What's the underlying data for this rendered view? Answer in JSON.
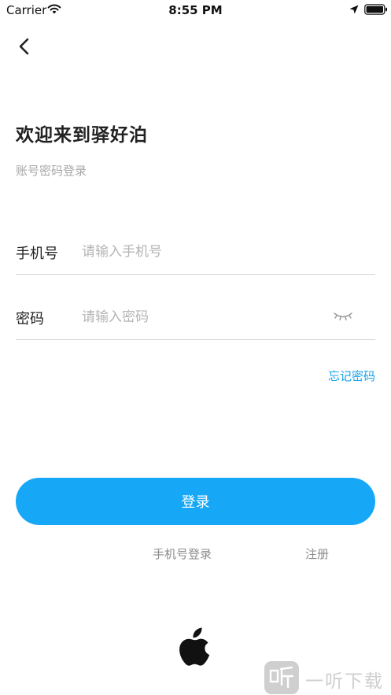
{
  "status_bar": {
    "carrier": "Carrier",
    "time": "8:55 PM"
  },
  "header": {
    "title": "欢迎来到驿好泊",
    "subtitle": "账号密码登录"
  },
  "form": {
    "phone": {
      "label": "手机号",
      "placeholder": "请输入手机号",
      "value": ""
    },
    "password": {
      "label": "密码",
      "placeholder": "请输入密码",
      "value": ""
    },
    "forgot_label": "忘记密码"
  },
  "actions": {
    "login_label": "登录",
    "phone_login_label": "手机号登录",
    "register_label": "注册"
  },
  "icons": {
    "back": "chevron-left-icon",
    "eye": "eye-closed-icon",
    "apple": "apple-icon"
  },
  "colors": {
    "accent": "#16a8f6",
    "link": "#1aa3e8",
    "placeholder": "#b4b4b4",
    "divider": "#d6d6d6"
  },
  "watermark": {
    "text": "一听下载"
  }
}
